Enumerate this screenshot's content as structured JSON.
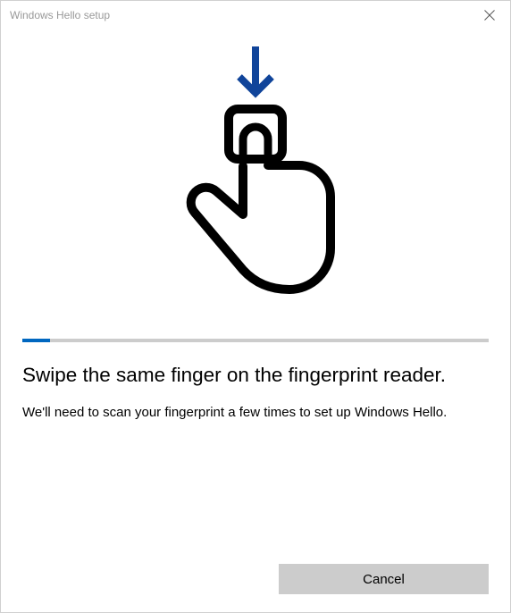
{
  "titlebar": {
    "title": "Windows Hello setup"
  },
  "progress": {
    "percent": 6
  },
  "main": {
    "heading": "Swipe the same finger on the fingerprint reader.",
    "body": "We'll need to scan your fingerprint a few times to set up Windows Hello."
  },
  "footer": {
    "cancel_label": "Cancel"
  },
  "colors": {
    "accent": "#0067c0"
  }
}
